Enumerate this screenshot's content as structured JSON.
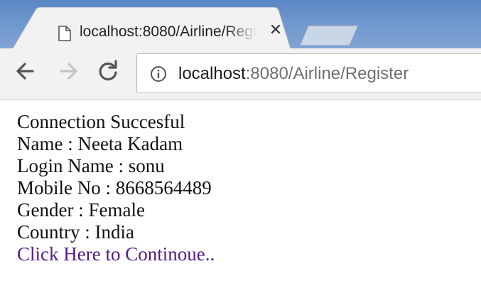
{
  "browser": {
    "tab": {
      "title": "localhost:8080/Airline/Register",
      "favicon": "page-icon",
      "close_glyph": "✕"
    },
    "toolbar": {
      "back_icon": "arrow-left-icon",
      "forward_icon": "arrow-right-icon",
      "reload_icon": "reload-icon"
    },
    "address_bar": {
      "info_icon": "info-icon",
      "host": "localhost",
      "rest": ":8080/Airline/Register"
    }
  },
  "page": {
    "status": "Connection Succesful",
    "name_line": "Name : Neeta Kadam",
    "login_line": "Login Name : sonu",
    "mobile_line": "Mobile No : 8668564489",
    "gender_line": "Gender : Female",
    "country_line": "Country : India",
    "continue_link": "Click Here to Continoue.."
  },
  "colors": {
    "link_visited": "#551a8b",
    "text": "#111111",
    "tabstrip": "#6f97cd",
    "toolbar": "#f2f2f2"
  }
}
